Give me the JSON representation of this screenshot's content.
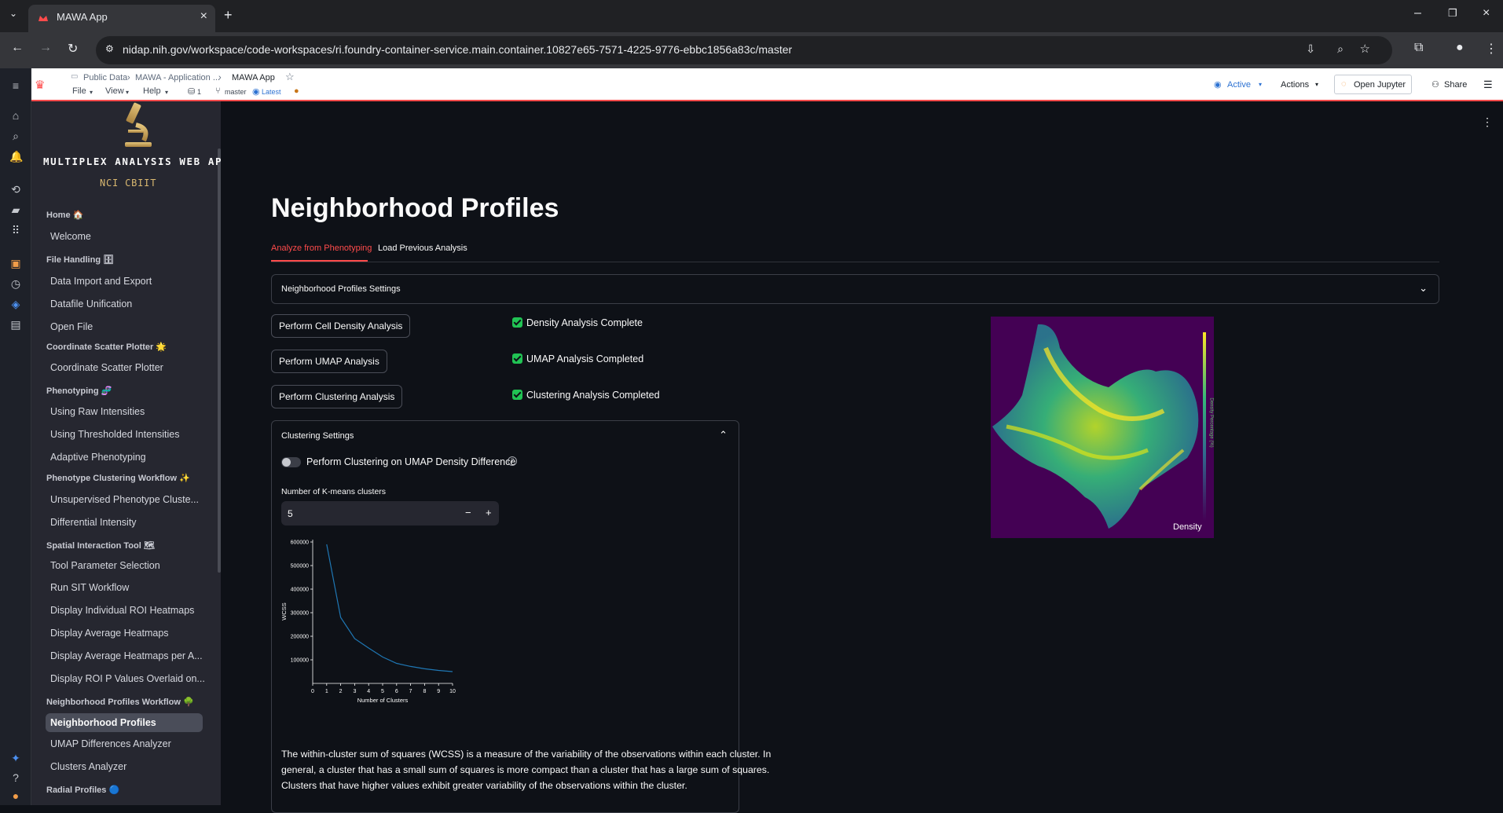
{
  "browser": {
    "tab_title": "MAWA App",
    "url": "nidap.nih.gov/workspace/code-workspaces/ri.foundry-container-service.main.container.10827e65-7571-4225-9776-ebbc1856a83c/master"
  },
  "app_header": {
    "breadcrumb": [
      "Public Data",
      "MAWA - Application ...",
      "MAWA App"
    ],
    "menus": [
      "File",
      "View",
      "Help"
    ],
    "workspace_count": "1",
    "branch": "master",
    "version": "Latest",
    "status": "Active",
    "actions_label": "Actions",
    "open_jupyter_label": "Open Jupyter",
    "share_label": "Share"
  },
  "sidebar": {
    "logo_title": "MULTIPLEX ANALYSIS WEB AP",
    "logo_subtitle": "NCI CBIIT",
    "sections": [
      {
        "head": "Home 🏠",
        "items": [
          "Welcome"
        ]
      },
      {
        "head": "File Handling 🗄",
        "items": [
          "Data Import and Export",
          "Datafile Unification",
          "Open File"
        ]
      },
      {
        "head": "Coordinate Scatter Plotter 🌟",
        "items": [
          "Coordinate Scatter Plotter"
        ]
      },
      {
        "head": "Phenotyping 🧬",
        "items": [
          "Using Raw Intensities",
          "Using Thresholded Intensities",
          "Adaptive Phenotyping"
        ]
      },
      {
        "head": "Phenotype Clustering Workflow ✨",
        "items": [
          "Unsupervised Phenotype Cluste...",
          "Differential Intensity"
        ]
      },
      {
        "head": "Spatial Interaction Tool 🗺",
        "items": [
          "Tool Parameter Selection",
          "Run SIT Workflow",
          "Display Individual ROI Heatmaps",
          "Display Average Heatmaps",
          "Display Average Heatmaps per A...",
          "Display ROI P Values Overlaid on..."
        ]
      },
      {
        "head": "Neighborhood Profiles Workflow 🌳",
        "items": [
          "Neighborhood Profiles",
          "UMAP Differences Analyzer",
          "Clusters Analyzer"
        ]
      },
      {
        "head": "Radial Profiles 🔵",
        "items": []
      }
    ],
    "active_item": "Neighborhood Profiles"
  },
  "main": {
    "title": "Neighborhood Profiles",
    "tabs": [
      "Analyze from Phenotyping",
      "Load Previous Analysis"
    ],
    "active_tab": "Analyze from Phenotyping",
    "settings_expander": "Neighborhood Profiles Settings",
    "buttons": {
      "density": "Perform Cell Density Analysis",
      "umap": "Perform UMAP Analysis",
      "clustering": "Perform Clustering Analysis"
    },
    "status": {
      "density": "Density Analysis Complete",
      "umap": "UMAP Analysis Completed",
      "clustering": "Clustering Analysis Completed"
    },
    "clustering_settings": {
      "title": "Clustering Settings",
      "toggle_label": "Perform Clustering on UMAP Density Difference",
      "kmeans_label": "Number of K-means clusters",
      "kmeans_value": "5",
      "minus": "−",
      "plus": "+"
    },
    "density_image": {
      "label": "Density",
      "colorbar_label": "Density Percentage (%)"
    },
    "description": "The within-cluster sum of squares (WCSS) is a measure of the variability of the observations within each cluster. In general, a cluster that has a small sum of squares is more compact than a cluster that has a large sum of squares. Clusters that have higher values exhibit greater variability of the observations within the cluster."
  },
  "chart_data": {
    "type": "line",
    "x": [
      1,
      2,
      3,
      4,
      5,
      6,
      7,
      8,
      9,
      10
    ],
    "series": [
      {
        "values": [
          590000,
          280000,
          190000,
          150000,
          112000,
          85000,
          72000,
          62000,
          55000,
          50000
        ]
      }
    ],
    "xlabel": "Number of Clusters",
    "ylabel": "WCSS",
    "xlim": [
      0,
      10
    ],
    "ylim": [
      0,
      610000
    ],
    "xticks": [
      0,
      1,
      2,
      3,
      4,
      5,
      6,
      7,
      8,
      9,
      10
    ],
    "yticks": [
      100000,
      200000,
      300000,
      400000,
      500000,
      600000
    ],
    "color": "#1f77b4"
  }
}
